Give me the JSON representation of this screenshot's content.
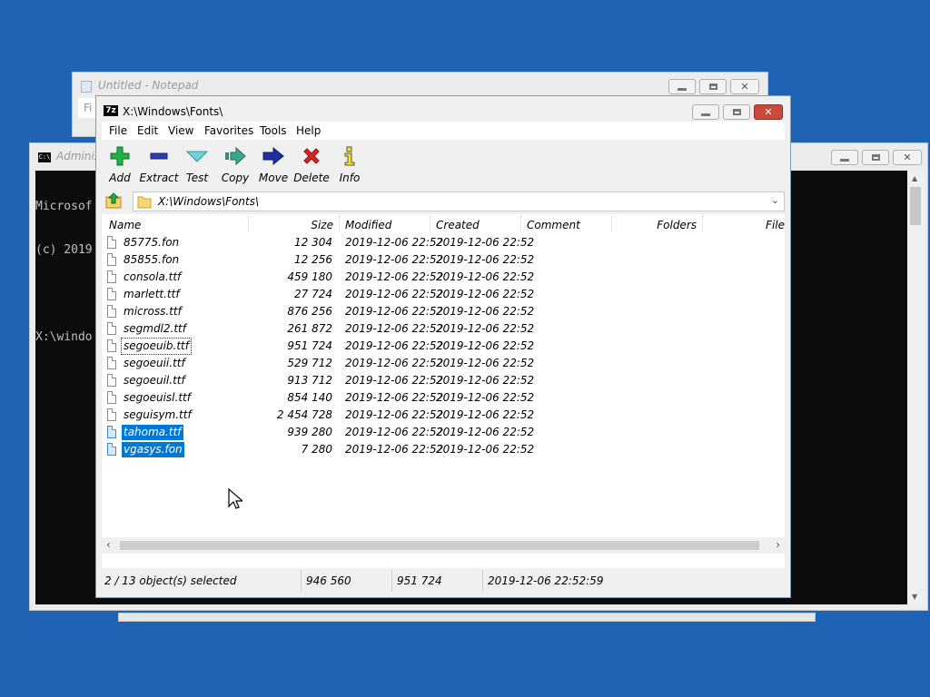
{
  "notepad": {
    "title": "Untitled - Notepad",
    "menu_first_letter": "Fi"
  },
  "console": {
    "title": "Adminis",
    "icon_label": "C:\\",
    "lines": [
      "Microsof",
      "(c) 2019",
      "",
      "X:\\windo"
    ]
  },
  "sevenzip": {
    "title": "X:\\Windows\\Fonts\\",
    "app_icon_label": "7z",
    "menu": [
      "File",
      "Edit",
      "View",
      "Favorites",
      "Tools",
      "Help"
    ],
    "toolbar": [
      {
        "label": "Add",
        "icon": "plus-icon"
      },
      {
        "label": "Extract",
        "icon": "minus-icon"
      },
      {
        "label": "Test",
        "icon": "check-arrow-icon"
      },
      {
        "label": "Copy",
        "icon": "copy-arrow-icon"
      },
      {
        "label": "Move",
        "icon": "move-arrow-icon"
      },
      {
        "label": "Delete",
        "icon": "delete-x-icon"
      },
      {
        "label": "Info",
        "icon": "info-icon"
      }
    ],
    "address": "X:\\Windows\\Fonts\\",
    "columns": [
      "Name",
      "Size",
      "Modified",
      "Created",
      "Comment",
      "Folders",
      "File"
    ],
    "files": [
      {
        "name": "85775.fon",
        "size": "12 304",
        "modified": "2019-12-06 22:52",
        "created": "2019-12-06 22:52"
      },
      {
        "name": "85855.fon",
        "size": "12 256",
        "modified": "2019-12-06 22:52",
        "created": "2019-12-06 22:52"
      },
      {
        "name": "consola.ttf",
        "size": "459 180",
        "modified": "2019-12-06 22:52",
        "created": "2019-12-06 22:52"
      },
      {
        "name": "marlett.ttf",
        "size": "27 724",
        "modified": "2019-12-06 22:52",
        "created": "2019-12-06 22:52"
      },
      {
        "name": "micross.ttf",
        "size": "876 256",
        "modified": "2019-12-06 22:52",
        "created": "2019-12-06 22:52"
      },
      {
        "name": "segmdl2.ttf",
        "size": "261 872",
        "modified": "2019-12-06 22:52",
        "created": "2019-12-06 22:52"
      },
      {
        "name": "segoeuib.ttf",
        "size": "951 724",
        "modified": "2019-12-06 22:52",
        "created": "2019-12-06 22:52"
      },
      {
        "name": "segoeuii.ttf",
        "size": "529 712",
        "modified": "2019-12-06 22:52",
        "created": "2019-12-06 22:52"
      },
      {
        "name": "segoeuil.ttf",
        "size": "913 712",
        "modified": "2019-12-06 22:52",
        "created": "2019-12-06 22:52"
      },
      {
        "name": "segoeuisl.ttf",
        "size": "854 140",
        "modified": "2019-12-06 22:52",
        "created": "2019-12-06 22:52"
      },
      {
        "name": "seguisym.ttf",
        "size": "2 454 728",
        "modified": "2019-12-06 22:52",
        "created": "2019-12-06 22:52"
      },
      {
        "name": "tahoma.ttf",
        "size": "939 280",
        "modified": "2019-12-06 22:52",
        "created": "2019-12-06 22:52"
      },
      {
        "name": "vgasys.fon",
        "size": "7 280",
        "modified": "2019-12-06 22:52",
        "created": "2019-12-06 22:52"
      }
    ],
    "status": {
      "selection": "2 / 13 object(s) selected",
      "selected_size": "946 560",
      "focused_size": "951 724",
      "focused_modified": "2019-12-06 22:52:59"
    },
    "accent": "#0078d7"
  }
}
